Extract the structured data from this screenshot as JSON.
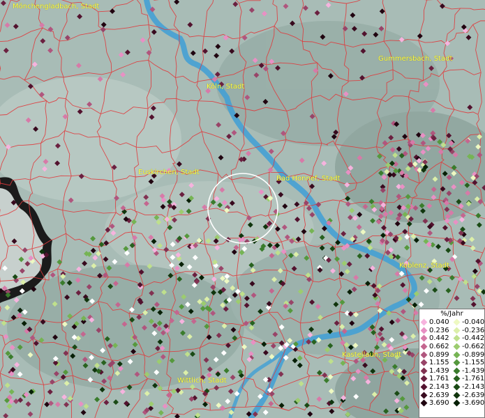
{
  "map": {
    "cities": [
      {
        "id": "moenchengladbach",
        "label": "Mönchengladbach, Stadt"
      },
      {
        "id": "gummersbach",
        "label": "Gummersbach, Stadt"
      },
      {
        "id": "koeln",
        "label": "Köln, Stadt"
      },
      {
        "id": "euskirchen",
        "label": "Euskirchen, Stadt"
      },
      {
        "id": "bad-honnef",
        "label": "Bad Honnef, Stadt"
      },
      {
        "id": "koblenz",
        "label": "Koblenz, Stadt"
      },
      {
        "id": "kastellaun",
        "label": "Kastellaun, Stadt"
      },
      {
        "id": "wittlich",
        "label": "Wittlich, Stadt"
      }
    ],
    "colors": {
      "boundary": "#e0393b",
      "river": "#3f9fd6",
      "terrain": "#a9bdb7",
      "outside_area": "#1a1a1a",
      "selection_circle": "#ffffff"
    }
  },
  "legend": {
    "title": "%/Jahr",
    "positive": [
      {
        "value": "0.040",
        "color": "#f6b3de"
      },
      {
        "value": "0.236",
        "color": "#e890c4"
      },
      {
        "value": "0.442",
        "color": "#d77aa8"
      },
      {
        "value": "0.662",
        "color": "#c4668f"
      },
      {
        "value": "0.899",
        "color": "#b0567e"
      },
      {
        "value": "1.155",
        "color": "#984468"
      },
      {
        "value": "1.439",
        "color": "#823252"
      },
      {
        "value": "1.761",
        "color": "#6b2040"
      },
      {
        "value": "2.143",
        "color": "#52122e"
      },
      {
        "value": "2.639",
        "color": "#380a1e"
      },
      {
        "value": "3.690",
        "color": "#200410"
      }
    ],
    "negative": [
      {
        "value": "-0.040",
        "color": "#eef9c2"
      },
      {
        "value": "-0.236",
        "color": "#dcefa9"
      },
      {
        "value": "-0.442",
        "color": "#bfe08c"
      },
      {
        "value": "-0.662",
        "color": "#9ccc6f"
      },
      {
        "value": "-0.899",
        "color": "#76b454"
      },
      {
        "value": "-1.155",
        "color": "#55983d"
      },
      {
        "value": "-1.439",
        "color": "#3a7c2c"
      },
      {
        "value": "-1.761",
        "color": "#28621f"
      },
      {
        "value": "-2.143",
        "color": "#1a4a15"
      },
      {
        "value": "-2.639",
        "color": "#10350d"
      },
      {
        "value": "-3.690",
        "color": "#071f06"
      }
    ]
  }
}
